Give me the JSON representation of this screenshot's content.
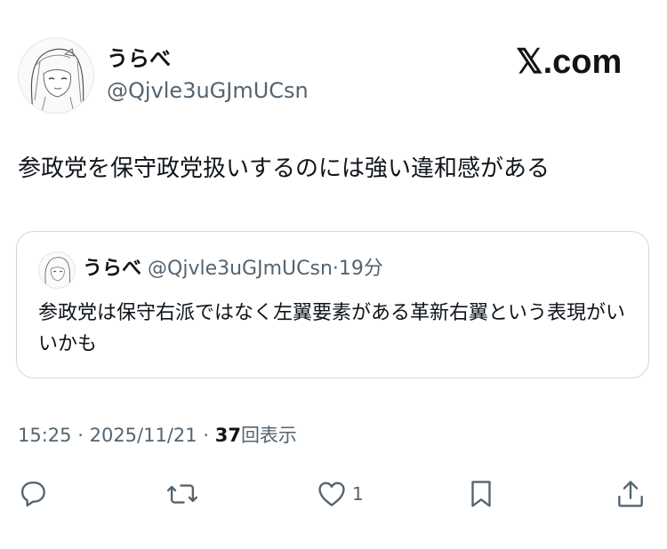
{
  "author": {
    "display_name": "うらべ",
    "handle": "@Qjvle3uGJmUCsn"
  },
  "brand": "𝕏.com",
  "post": {
    "text": "参政党を保守政党扱いするのには強い違和感がある",
    "time": "15:25",
    "date": "2025/11/21",
    "views_count": "37",
    "views_label": "回表示",
    "separator": "·"
  },
  "quote": {
    "display_name": "うらべ",
    "handle": "@Qjvle3uGJmUCsn",
    "separator": "·",
    "age": "19分",
    "text": "参政党は保守右派ではなく左翼要素がある革新右翼という表現がいいかも"
  },
  "actions": {
    "likes_count": "1",
    "icons": [
      "reply-icon",
      "repost-icon",
      "like-icon",
      "bookmark-icon",
      "share-icon"
    ]
  },
  "colors": {
    "text": "#0f1419",
    "secondary": "#536471",
    "border": "#cfd9de"
  }
}
